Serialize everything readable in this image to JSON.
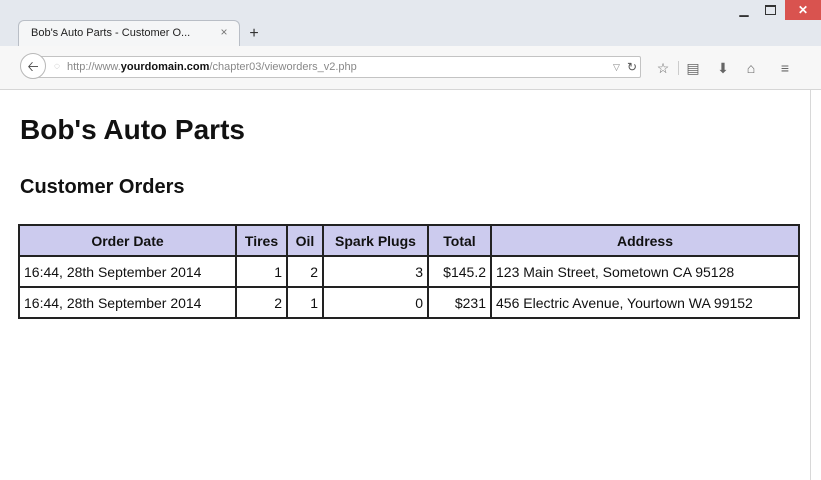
{
  "browser": {
    "tab_title": "Bob's Auto Parts - Customer O...",
    "tab_close": "×",
    "new_tab": "+",
    "url_prefix": "http://www.",
    "url_domain": "yourdomain.com",
    "url_path": "/chapter03/vieworders_v2.php"
  },
  "page": {
    "heading": "Bob's Auto Parts",
    "subheading": "Customer Orders"
  },
  "table": {
    "headers": [
      "Order Date",
      "Tires",
      "Oil",
      "Spark Plugs",
      "Total",
      "Address"
    ],
    "rows": [
      [
        "16:44, 28th September 2014",
        "1",
        "2",
        "3",
        "$145.2",
        "123 Main Street, Sometown CA 95128"
      ],
      [
        "16:44, 28th September 2014",
        "2",
        "1",
        "0",
        "$231",
        "456 Electric Avenue, Yourtown WA 99152"
      ]
    ]
  },
  "icons": {
    "back": "back-arrow-icon",
    "reload": "reload-icon",
    "bookmark": "star-icon",
    "reading_list": "clipboard-icon",
    "downloads": "download-arrow-icon",
    "home": "home-icon",
    "menu": "hamburger-menu-icon",
    "globe": "globe-icon"
  },
  "colors": {
    "table_header_bg": "#cccbee",
    "close_button_bg": "#d9534f"
  }
}
